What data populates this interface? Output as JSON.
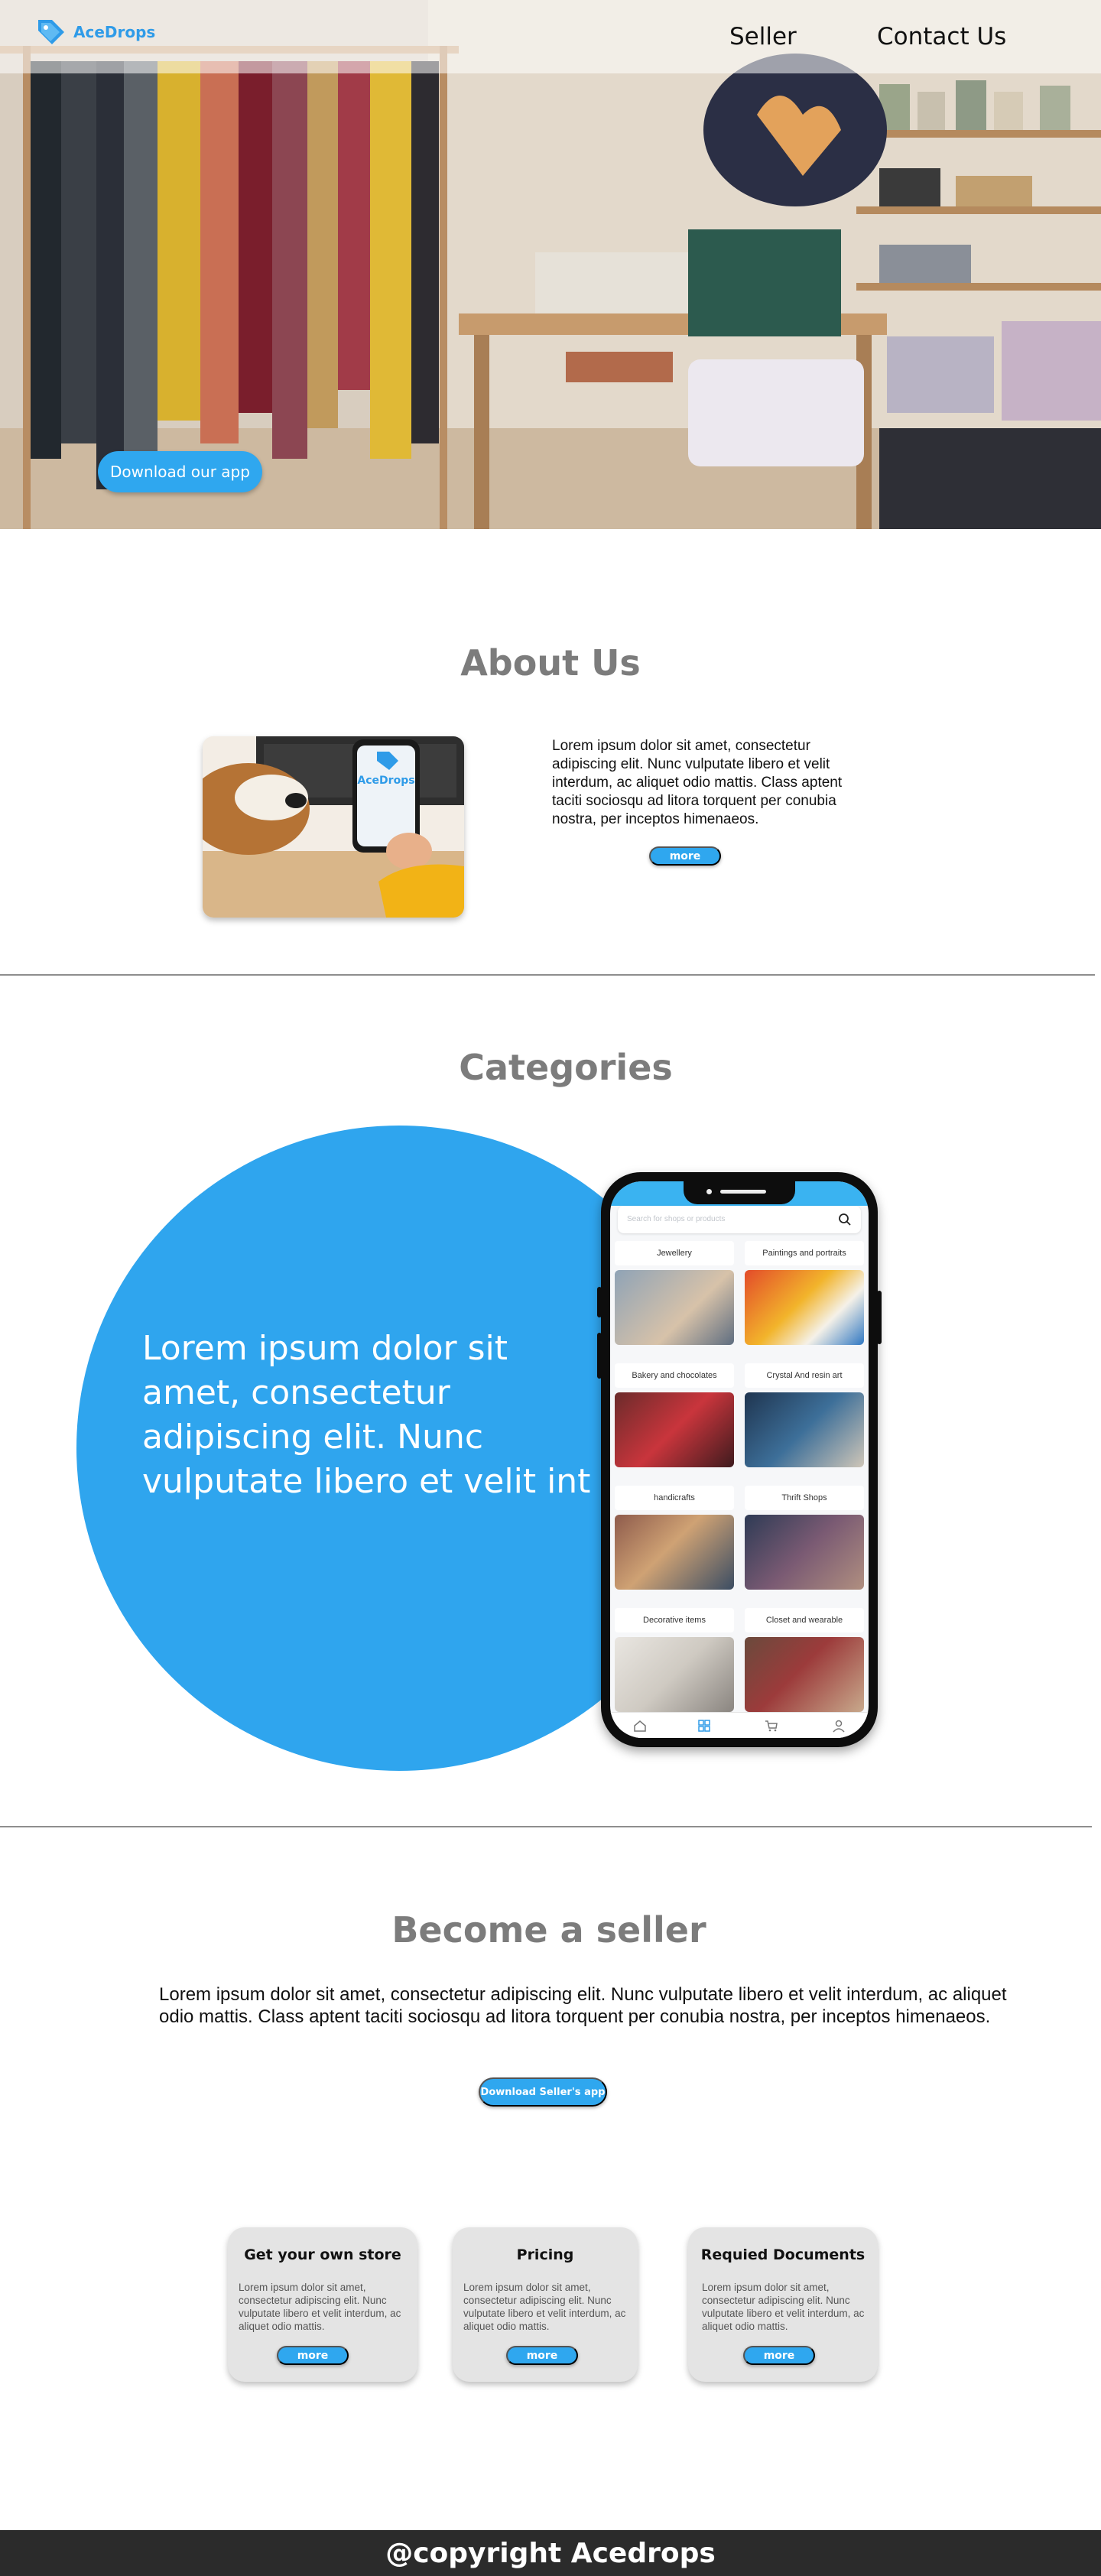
{
  "brand": {
    "name": "AceDrops",
    "accent": "#2fa7ef"
  },
  "nav": {
    "seller": "Seller",
    "contact": "Contact Us"
  },
  "hero": {
    "download_button": "Download our app"
  },
  "about": {
    "title": "About Us",
    "image_app_label": "AceDrops",
    "text": "Lorem ipsum dolor sit amet, consectetur adipiscing elit. Nunc vulputate libero et velit interdum, ac aliquet odio mattis. Class aptent taciti sociosqu ad litora torquent per conubia nostra, per inceptos himenaeos.",
    "more": "more"
  },
  "categories": {
    "title": "Categories",
    "circle_text": "Lorem ipsum dolor sit amet, consectetur adipiscing elit. Nunc vulputate libero et velit int",
    "phone": {
      "search_placeholder": "Search for shops or products",
      "items": [
        "Jewellery",
        "Paintings and portraits",
        "Bakery and chocolates",
        "Crystal And resin art",
        "handicrafts",
        "Thrift Shops",
        "Decorative items",
        "Closet and wearable"
      ],
      "tabs": [
        "home-icon",
        "grid-icon",
        "cart-icon",
        "profile-icon"
      ]
    }
  },
  "seller": {
    "title": "Become a seller",
    "text": "Lorem ipsum dolor sit amet, consectetur adipiscing elit. Nunc vulputate libero et velit interdum, ac aliquet odio mattis. Class aptent taciti sociosqu ad litora torquent per conubia nostra, per inceptos himenaeos.",
    "download_button": "Download Seller's app",
    "cards": [
      {
        "title": "Get your own store",
        "body": "Lorem ipsum dolor sit amet, consectetur adipiscing elit. Nunc vulputate libero et velit interdum, ac aliquet odio mattis.",
        "more": "more"
      },
      {
        "title": "Pricing",
        "body": "Lorem ipsum dolor sit amet, consectetur adipiscing elit. Nunc vulputate libero et velit interdum, ac aliquet odio mattis.",
        "more": "more"
      },
      {
        "title": "Requied Documents",
        "body": "Lorem ipsum dolor sit amet, consectetur adipiscing elit. Nunc vulputate libero et velit interdum, ac aliquet odio mattis.",
        "more": "more"
      }
    ]
  },
  "footer": {
    "text": "@copyright Acedrops"
  }
}
